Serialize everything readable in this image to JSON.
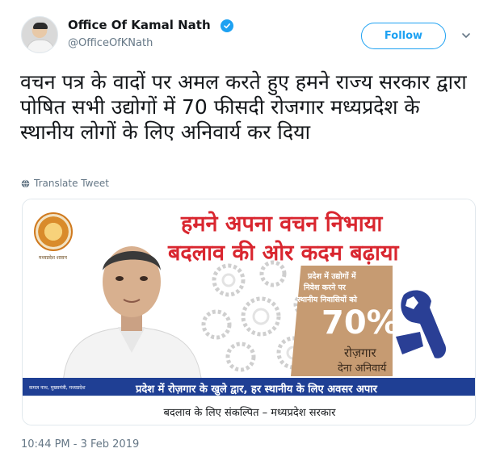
{
  "user": {
    "name": "Office Of Kamal Nath",
    "handle": "@OfficeOfKNath"
  },
  "header": {
    "follow_label": "Follow"
  },
  "tweet": {
    "text": "वचन पत्र के वादों पर अमल करते हुए हमने राज्य सरकार द्वारा पोषित सभी उद्योगों में 70 फीसदी रोजगार मध्यप्रदेश के स्थानीय लोगों के लिए अनिवार्य कर दिया",
    "translate_label": "Translate Tweet",
    "timestamp": "10:44 PM - 3 Feb 2019"
  },
  "media": {
    "headline_1": "हमने अपना वचन निभाया",
    "headline_2": "बदलाव की ओर कदम बढ़ाया",
    "emblem_caption": "मध्यप्रदेश शासन",
    "promise_line_1": "प्रदेश में उद्योगों में",
    "promise_line_2": "निवेश करने पर",
    "promise_line_3": "स्थानीय निवासियों को",
    "promise_percent": "70%",
    "promise_line_4": "रोज़गार",
    "promise_line_5": "देना अनिवार्य",
    "banner_caption": "कमल नाथ, मुख्यमंत्री, मध्यप्रदेश",
    "banner_text": "प्रदेश में रोज़गार के खुले द्वार, हर स्थानीय के लिए अवसर अपार",
    "footer_text": "बदलाव के लिए संकल्पित – मध्यप्रदेश सरकार"
  },
  "colors": {
    "accent": "#1da1f2",
    "headline": "#d9262f",
    "banner": "#1f3f94",
    "panel": "#c69b72"
  },
  "icons": {
    "verified": "verified-badge-icon",
    "chevron": "chevron-down-icon",
    "globe": "globe-icon",
    "wrench": "wrench-icon"
  }
}
